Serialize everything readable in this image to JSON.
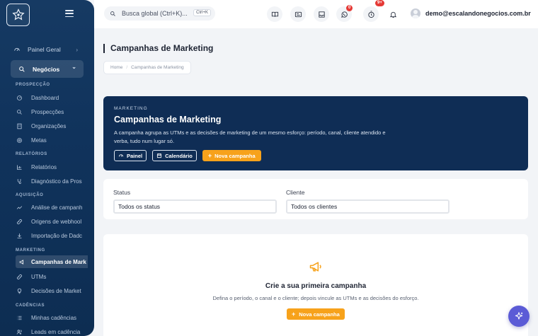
{
  "sidebar": {
    "top": {
      "label": "Painel Geral"
    },
    "active_group": {
      "label": "Negócios"
    },
    "sections": [
      {
        "title": "PROSPECÇÃO",
        "items": [
          {
            "label": "Dashboard",
            "icon": "dashboard-icon"
          },
          {
            "label": "Prospecções",
            "icon": "search-icon"
          },
          {
            "label": "Organizações",
            "icon": "building-icon"
          },
          {
            "label": "Metas",
            "icon": "target-icon"
          }
        ]
      },
      {
        "title": "RELATÓRIOS",
        "items": [
          {
            "label": "Relatórios",
            "icon": "chart-icon"
          },
          {
            "label": "Diagnóstico da Pros",
            "icon": "diagnostic-icon"
          }
        ]
      },
      {
        "title": "AQUISIÇÃO",
        "items": [
          {
            "label": "Análise de campanh",
            "icon": "trend-icon"
          },
          {
            "label": "Origens de webhool",
            "icon": "webhook-icon"
          },
          {
            "label": "Importação de Dadc",
            "icon": "import-icon"
          }
        ]
      },
      {
        "title": "MARKETING",
        "items": [
          {
            "label": "Campanhas de Mark",
            "icon": "megaphone-icon",
            "active": true
          },
          {
            "label": "UTMs",
            "icon": "link-icon"
          },
          {
            "label": "Decisões de Market",
            "icon": "lightbulb-icon"
          }
        ]
      },
      {
        "title": "CADÊNCIAS",
        "items": [
          {
            "label": "Minhas cadências",
            "icon": "list-icon"
          },
          {
            "label": "Leads em cadência",
            "icon": "users-icon"
          }
        ]
      }
    ]
  },
  "topbar": {
    "search_placeholder": "Busca global (Ctrl+K)...",
    "search_shortcut": "Ctrl+K",
    "whatsapp_badge": "0",
    "timer_badge": "9+",
    "user_email": "demo@escalandonegocios.com.br"
  },
  "page": {
    "title": "Campanhas de Marketing",
    "breadcrumb": [
      "Home",
      "Campanhas de Marketing"
    ]
  },
  "hero": {
    "kicker": "MARKETING",
    "title": "Campanhas de Marketing",
    "description": "A campanha agrupa as UTMs e as decisões de marketing de um mesmo esforço: período, canal, cliente atendido e verba, tudo num lugar só.",
    "buttons": {
      "panel": "Painel",
      "calendar": "Calendário",
      "new": "Nova campanha"
    }
  },
  "filters": {
    "status_label": "Status",
    "status_value": "Todos os status",
    "client_label": "Cliente",
    "client_value": "Todos os clientes"
  },
  "empty_state": {
    "title": "Crie a sua primeira campanha",
    "description": "Defina o período, o canal e o cliente; depois vincule as UTMs e as decisões do esforço.",
    "button": "Nova campanha"
  },
  "colors": {
    "accent": "#f7a21b",
    "sidebar": "#10335c",
    "hero": "#0f2d55",
    "fab": "#5b5bd6",
    "badge": "#e53935"
  }
}
